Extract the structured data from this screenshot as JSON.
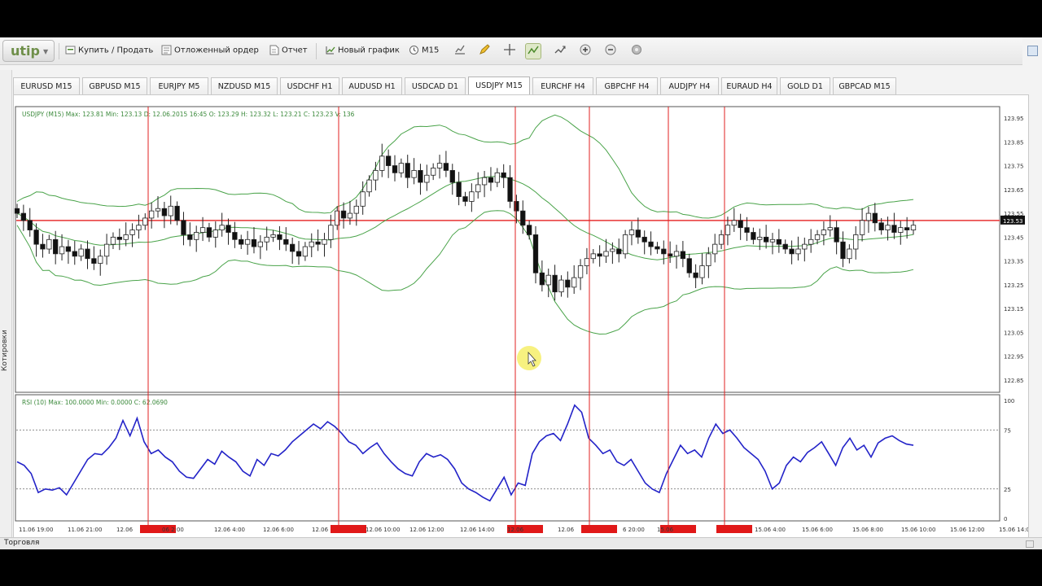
{
  "toolbar": {
    "logo": "utip",
    "buy_sell_label": "Купить / Продать",
    "pending_order_label": "Отложенный ордер",
    "report_label": "Отчет",
    "new_chart_label": "Новый график",
    "timeframe_label": "M15"
  },
  "tabs": [
    {
      "label": "EURUSD  M15"
    },
    {
      "label": "GBPUSD  M15"
    },
    {
      "label": "EURJPY  M5"
    },
    {
      "label": "NZDUSD  M15"
    },
    {
      "label": "USDCHF  H1"
    },
    {
      "label": "AUDUSD  H1"
    },
    {
      "label": "USDCAD  D1"
    },
    {
      "label": "USDJPY  M15"
    },
    {
      "label": "EURCHF  H4"
    },
    {
      "label": "GBPCHF  H4"
    },
    {
      "label": "AUDJPY  H4"
    },
    {
      "label": "EURAUD  H4"
    },
    {
      "label": "GOLD  D1"
    },
    {
      "label": "GBPCAD  M15"
    }
  ],
  "left_panel": {
    "label": "Котировки"
  },
  "status_bar": {
    "label": "Торговля"
  },
  "chart_data": [
    {
      "type": "candlestick",
      "title": "USDJPY (M15)  Max: 123.81  Min: 123.13  D: 12.06.2015 16:45  O: 123.29  H: 123.32  L: 123.21  C: 123.23  V: 136",
      "ylim": [
        122.85,
        123.95
      ],
      "y_ticks": [
        "123.95",
        "123.85",
        "123.75",
        "123.65",
        "123.55",
        "123.45",
        "123.35",
        "123.25",
        "123.15",
        "123.05",
        "122.95",
        "122.85"
      ],
      "current_price_label": "123.53",
      "horizontal_line_price": 123.52,
      "close_series": [
        123.55,
        123.52,
        123.48,
        123.42,
        123.4,
        123.44,
        123.38,
        123.41,
        123.39,
        123.37,
        123.4,
        123.36,
        123.34,
        123.37,
        123.42,
        123.45,
        123.44,
        123.46,
        123.48,
        123.5,
        123.53,
        123.56,
        123.57,
        123.54,
        123.58,
        123.52,
        123.46,
        123.44,
        123.47,
        123.49,
        123.45,
        123.48,
        123.5,
        123.47,
        123.44,
        123.42,
        123.44,
        123.41,
        123.43,
        123.45,
        123.46,
        123.44,
        123.42,
        123.39,
        123.37,
        123.41,
        123.43,
        123.42,
        123.44,
        123.5,
        123.56,
        123.53,
        123.55,
        123.58,
        123.64,
        123.69,
        123.73,
        123.79,
        123.75,
        123.72,
        123.76,
        123.7,
        123.73,
        123.68,
        123.71,
        123.74,
        123.76,
        123.73,
        123.68,
        123.62,
        123.6,
        123.64,
        123.67,
        123.7,
        123.68,
        123.72,
        123.7,
        123.6,
        123.56,
        123.5,
        123.46,
        123.3,
        123.25,
        123.29,
        123.22,
        123.27,
        123.24,
        123.28,
        123.33,
        123.36,
        123.38,
        123.37,
        123.39,
        123.4,
        123.38,
        123.46,
        123.48,
        123.45,
        123.43,
        123.41,
        123.4,
        123.38,
        123.37,
        123.39,
        123.36,
        123.3,
        123.28,
        123.33,
        123.38,
        123.42,
        123.46,
        123.5,
        123.52,
        123.49,
        123.47,
        123.44,
        123.45,
        123.43,
        123.44,
        123.42,
        123.4,
        123.38,
        123.4,
        123.42,
        123.44,
        123.46,
        123.48,
        123.49,
        123.43,
        123.36,
        123.4,
        123.46,
        123.52,
        123.55,
        123.51,
        123.48,
        123.5,
        123.47,
        123.49,
        123.48,
        123.5
      ]
    },
    {
      "type": "line",
      "title": "RSI (10)  Max: 100.0000  Min: 0.0000  C: 62.0690",
      "ylim": [
        0,
        100
      ],
      "y_ticks": [
        "100",
        "75",
        "25",
        "0"
      ],
      "levels": [
        75,
        25
      ],
      "series": [
        {
          "values": [
            48,
            45,
            38,
            22,
            25,
            24,
            26,
            20,
            30,
            40,
            50,
            55,
            54,
            60,
            68,
            83,
            70,
            85,
            65,
            55,
            58,
            52,
            48,
            40,
            35,
            34,
            42,
            50,
            46,
            57,
            52,
            48,
            40,
            36,
            50,
            45,
            55,
            53,
            58,
            65,
            70,
            75,
            80,
            76,
            82,
            78,
            72,
            65,
            62,
            55,
            60,
            64,
            55,
            48,
            42,
            38,
            36,
            48,
            55,
            52,
            54,
            50,
            42,
            30,
            25,
            22,
            18,
            15,
            25,
            35,
            20,
            30,
            28,
            55,
            65,
            70,
            72,
            66,
            80,
            96,
            90,
            68,
            62,
            55,
            58,
            48,
            45,
            50,
            40,
            30,
            25,
            22,
            38,
            50,
            62,
            55,
            58,
            52,
            68,
            80,
            72,
            75,
            68,
            60,
            55,
            50,
            40,
            25,
            30,
            45,
            52,
            48,
            56,
            60,
            65,
            55,
            45,
            60,
            68,
            58,
            62,
            52,
            64,
            68,
            70,
            66,
            63,
            62
          ]
        }
      ],
      "x_ticks": [
        "11.06 19:00",
        "11.06 21:00",
        "12.06",
        "06 2:00",
        "12.06 4:00",
        "12.06 6:00",
        "12.06",
        "12.06 10:00",
        "12.06 12:00",
        "12.06 14:00",
        "12.06",
        "12.06",
        "6 20:00",
        "15.06",
        "15.06 4:00",
        "15.06 6:00",
        "15.06 8:00",
        "15.06 10:00",
        "15.06 12:00",
        "15.06 14:00"
      ]
    }
  ],
  "colors": {
    "bollinger": "#49a349",
    "ma": "#c8643c",
    "rsi": "#2323c8",
    "marker_lines": "#e02020",
    "price_line": "#e83232",
    "accent": "#7a9b3e"
  },
  "icons": [
    "buy-sell-icon",
    "pending-order-icon",
    "report-icon",
    "new-chart-icon",
    "clock-icon",
    "chart-style-icon",
    "pencil-icon",
    "crosshair-icon",
    "indicator-icon",
    "trend-icon",
    "zoom-in-icon",
    "zoom-out-icon",
    "settings-icon",
    "window-icon"
  ]
}
